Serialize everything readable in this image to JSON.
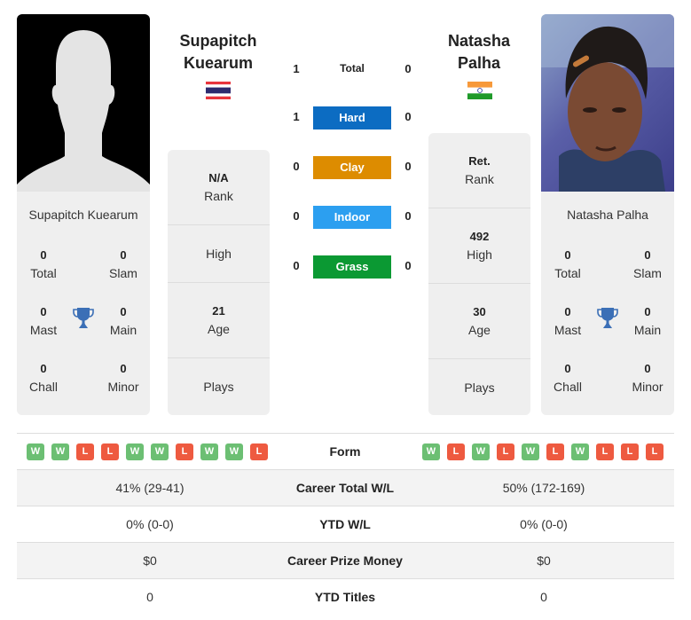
{
  "colors": {
    "hard": "#0c6cc2",
    "clay": "#dd8c00",
    "indoor": "#2c9ff0",
    "grass": "#0b9933",
    "win": "#6cbf73",
    "loss": "#ee5a40",
    "trophy": "#3b6fb6"
  },
  "player1": {
    "name_line1": "Supapitch",
    "name_line2": "Kuearum",
    "full_name": "Supapitch Kuearum",
    "flag": "thailand-flag",
    "photo": "silhouette-placeholder",
    "titles": {
      "total": {
        "value": "0",
        "label": "Total"
      },
      "slam": {
        "value": "0",
        "label": "Slam"
      },
      "mast": {
        "value": "0",
        "label": "Mast"
      },
      "main": {
        "value": "0",
        "label": "Main"
      },
      "chall": {
        "value": "0",
        "label": "Chall"
      },
      "minor": {
        "value": "0",
        "label": "Minor"
      }
    },
    "info": {
      "rank": {
        "value": "N/A",
        "label": "Rank"
      },
      "high": {
        "value": "",
        "label": "High"
      },
      "age": {
        "value": "21",
        "label": "Age"
      },
      "plays": {
        "value": "",
        "label": "Plays"
      }
    },
    "form": [
      "W",
      "W",
      "L",
      "L",
      "W",
      "W",
      "L",
      "W",
      "W",
      "L"
    ],
    "career_wl": "41% (29-41)",
    "ytd_wl": "0% (0-0)",
    "prize": "$0",
    "ytd_titles": "0"
  },
  "player2": {
    "name_line1": "Natasha",
    "name_line2": "Palha",
    "full_name": "Natasha Palha",
    "flag": "india-flag",
    "photo": "player-photo",
    "titles": {
      "total": {
        "value": "0",
        "label": "Total"
      },
      "slam": {
        "value": "0",
        "label": "Slam"
      },
      "mast": {
        "value": "0",
        "label": "Mast"
      },
      "main": {
        "value": "0",
        "label": "Main"
      },
      "chall": {
        "value": "0",
        "label": "Chall"
      },
      "minor": {
        "value": "0",
        "label": "Minor"
      }
    },
    "info": {
      "rank": {
        "value": "Ret.",
        "label": "Rank"
      },
      "high": {
        "value": "492",
        "label": "High"
      },
      "age": {
        "value": "30",
        "label": "Age"
      },
      "plays": {
        "value": "",
        "label": "Plays"
      }
    },
    "form": [
      "W",
      "L",
      "W",
      "L",
      "W",
      "L",
      "W",
      "L",
      "L",
      "L"
    ],
    "career_wl": "50% (172-169)",
    "ytd_wl": "0% (0-0)",
    "prize": "$0",
    "ytd_titles": "0"
  },
  "h2h": {
    "total": {
      "label": "Total",
      "p1": "1",
      "p2": "0"
    },
    "hard": {
      "label": "Hard",
      "p1": "1",
      "p2": "0"
    },
    "clay": {
      "label": "Clay",
      "p1": "0",
      "p2": "0"
    },
    "indoor": {
      "label": "Indoor",
      "p1": "0",
      "p2": "0"
    },
    "grass": {
      "label": "Grass",
      "p1": "0",
      "p2": "0"
    }
  },
  "labels": {
    "form": "Form",
    "career_wl": "Career Total W/L",
    "ytd_wl": "YTD W/L",
    "prize": "Career Prize Money",
    "ytd_titles": "YTD Titles"
  }
}
